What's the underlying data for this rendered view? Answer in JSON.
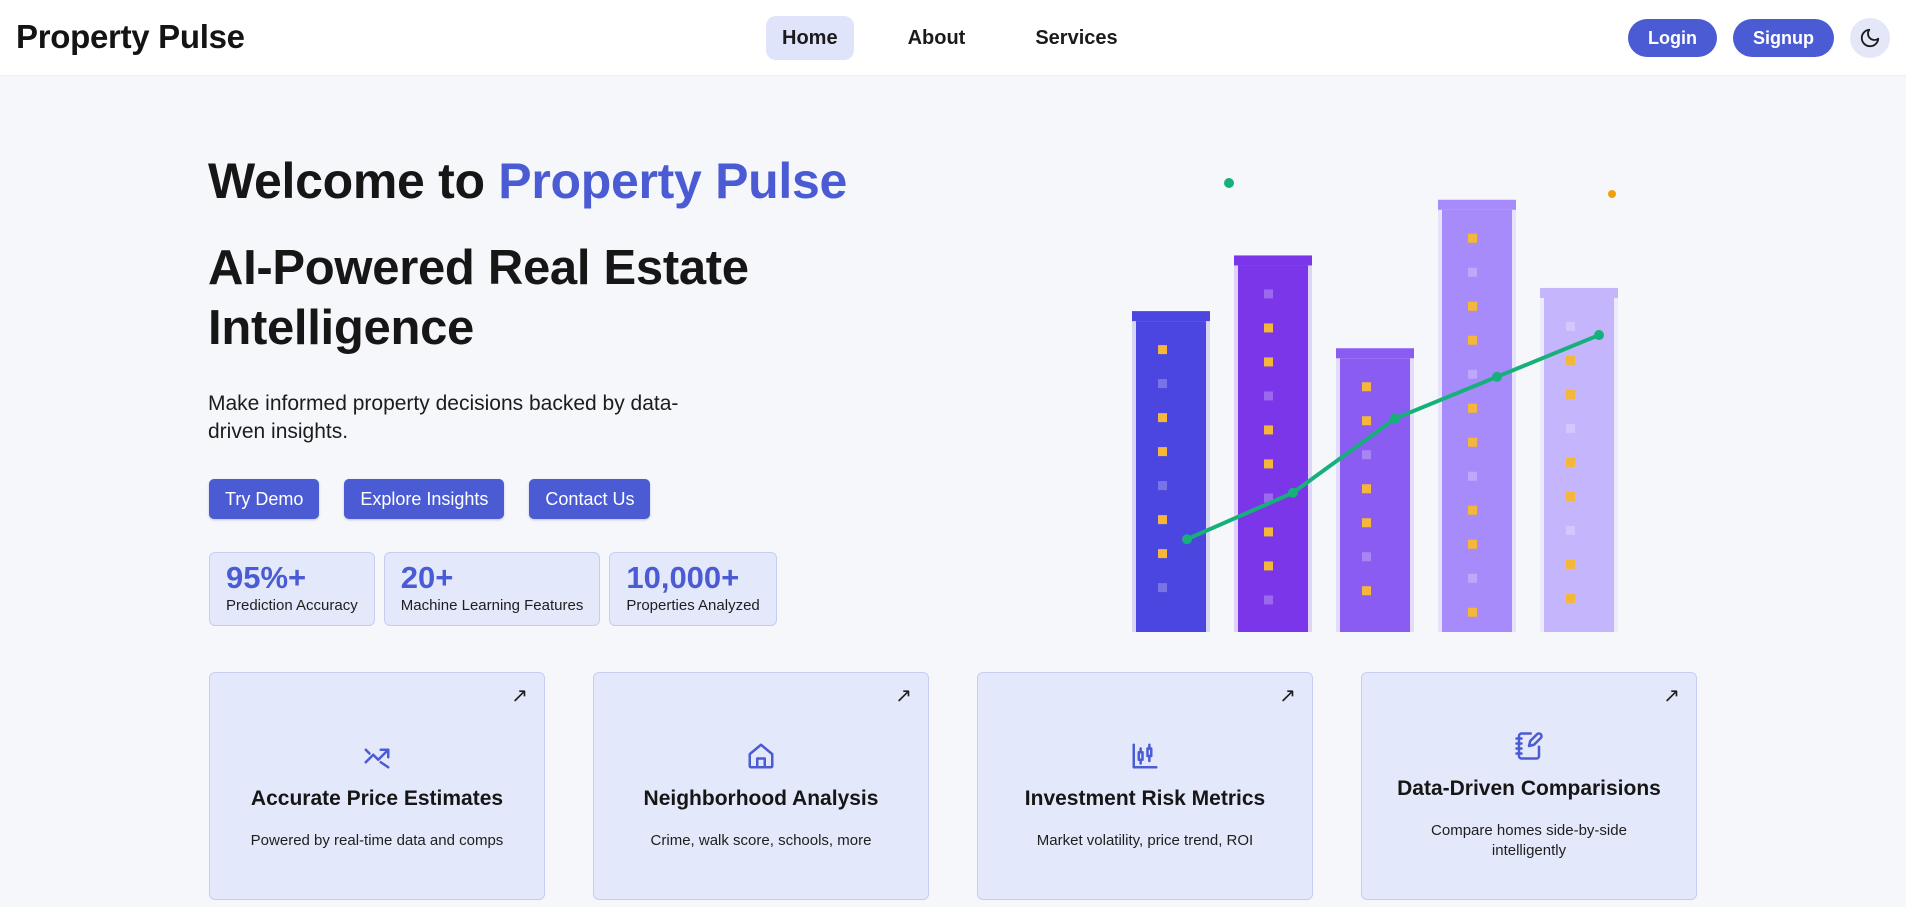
{
  "nav": {
    "brand": "Property Pulse",
    "links": [
      "Home",
      "About",
      "Services"
    ],
    "login": "Login",
    "signup": "Signup",
    "theme_icon": "moon-icon"
  },
  "hero": {
    "welcome_prefix": "Welcome to ",
    "welcome_accent": "Property Pulse",
    "headline": "AI-Powered Real Estate Intelligence",
    "lead": "Make informed property decisions backed by data-driven insights.",
    "ctas": [
      "Try Demo",
      "Explore Insights",
      "Contact Us"
    ],
    "stats": [
      {
        "value": "95%+",
        "label": "Prediction Accuracy"
      },
      {
        "value": "20+",
        "label": "Machine Learning Features"
      },
      {
        "value": "10,000+",
        "label": "Properties Analyzed"
      }
    ]
  },
  "illustration": {
    "bar_colors": [
      "#4b46e0",
      "#7a36e8",
      "#8b5cf2",
      "#a78bfa",
      "#c4b5fd"
    ],
    "relative_heights": [
      0.67,
      0.79,
      0.59,
      0.91,
      0.72
    ],
    "trend_points": [
      0.2,
      0.3,
      0.46,
      0.55,
      0.64
    ],
    "line_color": "#16b07a",
    "window_color": "#f5b73a"
  },
  "features": [
    {
      "icon": "trend-up-icon",
      "title": "Accurate Price Estimates",
      "desc": "Powered by real-time data and comps"
    },
    {
      "icon": "home-icon",
      "title": "Neighborhood Analysis",
      "desc": "Crime, walk score, schools, more"
    },
    {
      "icon": "candlestick-chart-icon",
      "title": "Investment Risk Metrics",
      "desc": "Market volatility, price trend, ROI"
    },
    {
      "icon": "notebook-pen-icon",
      "title": "Data-Driven Comparisions",
      "desc": "Compare homes side-by-side intelligently"
    }
  ],
  "colors": {
    "accent": "#4a5bd3",
    "card_bg": "#e4e8fb",
    "page_bg": "#f6f7fb"
  }
}
